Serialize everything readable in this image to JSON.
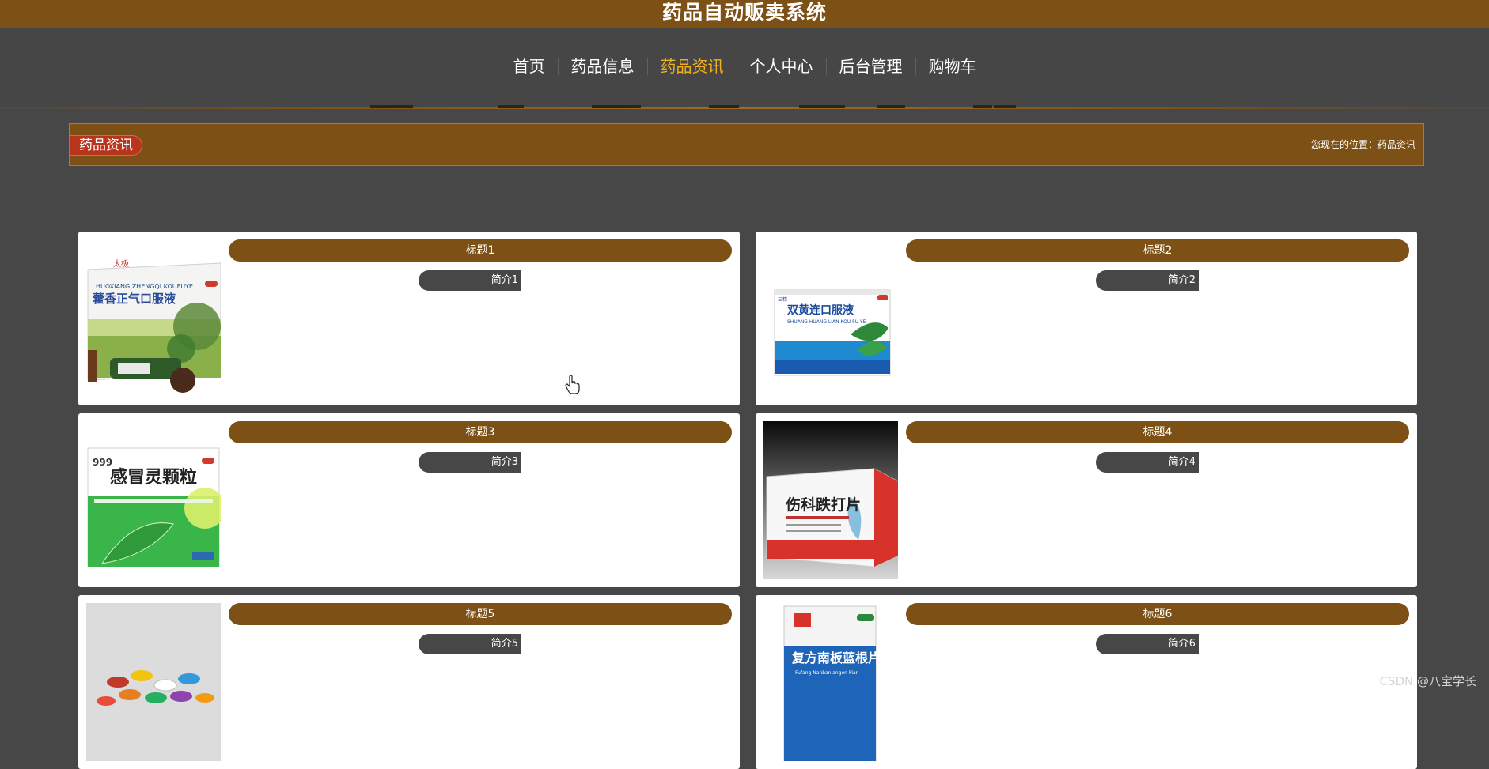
{
  "header": {
    "title": "药品自动贩卖系统"
  },
  "nav": {
    "items": [
      {
        "label": "首页",
        "name": "nav-item-home",
        "active": false
      },
      {
        "label": "药品信息",
        "name": "nav-item-drug-info",
        "active": false
      },
      {
        "label": "药品资讯",
        "name": "nav-item-drug-news",
        "active": true
      },
      {
        "label": "个人中心",
        "name": "nav-item-personal-center",
        "active": false
      },
      {
        "label": "后台管理",
        "name": "nav-item-admin",
        "active": false
      },
      {
        "label": "购物车",
        "name": "nav-item-cart",
        "active": false
      }
    ]
  },
  "breadcrumb": {
    "section_label": "药品资讯",
    "location_text": "您现在的位置：药品资讯"
  },
  "news": [
    {
      "title": "标题1",
      "intro": "简介1",
      "product_image": "藿香正气口服液",
      "brand": "太极",
      "pinyin": "HUOXIANG ZHENGQI KOUFUYE"
    },
    {
      "title": "标题2",
      "intro": "简介2",
      "product_image": "双黄连口服液",
      "brand": "三精",
      "pinyin": "SHUANG HUANG LIAN KOU FU YE"
    },
    {
      "title": "标题3",
      "intro": "简介3",
      "product_image": "感冒灵颗粒",
      "brand": "999",
      "pinyin": ""
    },
    {
      "title": "标题4",
      "intro": "简介4",
      "product_image": "伤科跌打片",
      "brand": "",
      "pinyin": ""
    },
    {
      "title": "标题5",
      "intro": "简介5",
      "product_image": "capsules-photo",
      "brand": "",
      "pinyin": ""
    },
    {
      "title": "标题6",
      "intro": "简介6",
      "product_image": "复方南板蓝根片",
      "brand": "",
      "pinyin": "Fufang Nanbanlangen Pian"
    }
  ],
  "watermark": "CSDN @八宝学长",
  "colors": {
    "accent": "#7d5015",
    "background": "#474747",
    "nav_active": "#f2ae1b",
    "badge": "#b9341d"
  }
}
